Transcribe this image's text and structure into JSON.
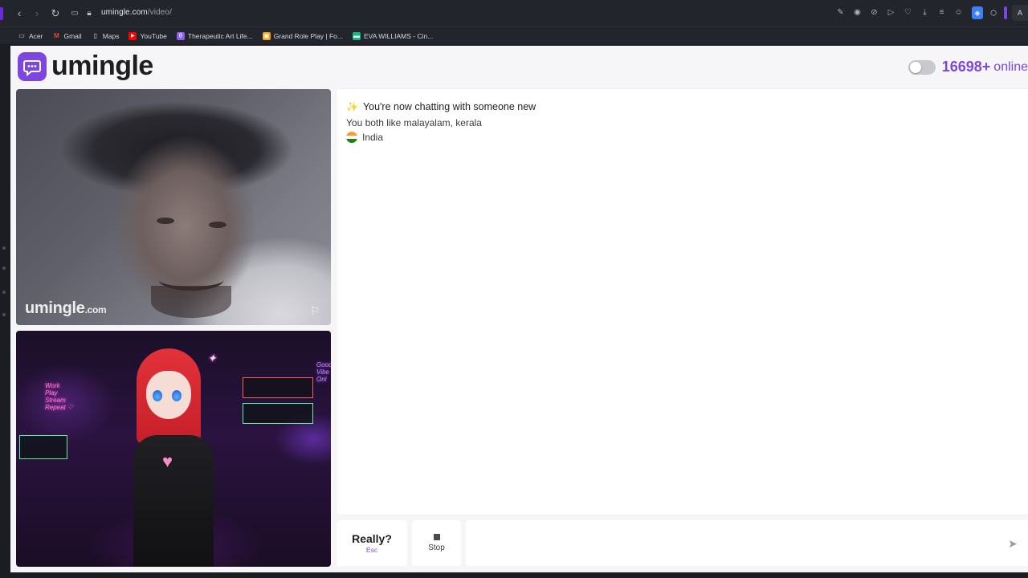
{
  "browser": {
    "url_host": "umingle.com",
    "url_path": "/video/",
    "nav": {
      "back": "‹",
      "forward": "›",
      "reload": "↻"
    },
    "right_edge_label": "A"
  },
  "bookmarks": [
    {
      "label": "Acer",
      "icon": "folder-icon",
      "color": "#d6d9e0"
    },
    {
      "label": "Gmail",
      "icon": "gmail-icon",
      "color": "#ea4335"
    },
    {
      "label": "Maps",
      "icon": "maps-icon",
      "color": "#d6d9e0"
    },
    {
      "label": "YouTube",
      "icon": "youtube-icon",
      "color": "#ff0000"
    },
    {
      "label": "Therapeutic Art Life...",
      "icon": "art-icon",
      "color": "#8b5cf6"
    },
    {
      "label": "Grand Role Play | Fo...",
      "icon": "grp-icon",
      "color": "#f59e0b"
    },
    {
      "label": "EVA WILLIAMS - Cin...",
      "icon": "eva-icon",
      "color": "#10b981"
    }
  ],
  "site": {
    "logo_text": "umingle",
    "brand_color": "#7b47e0",
    "online_count": "16698+",
    "online_label": "online"
  },
  "video": {
    "watermark_main": "umingle",
    "watermark_tld": ".com"
  },
  "chat": {
    "status_line": "You're now chatting with someone new",
    "interests_line": "You both like malayalam, kerala",
    "country": "India"
  },
  "controls": {
    "skip_label": "Really?",
    "skip_hint": "Esc",
    "stop_label": "Stop",
    "message_placeholder": ""
  }
}
